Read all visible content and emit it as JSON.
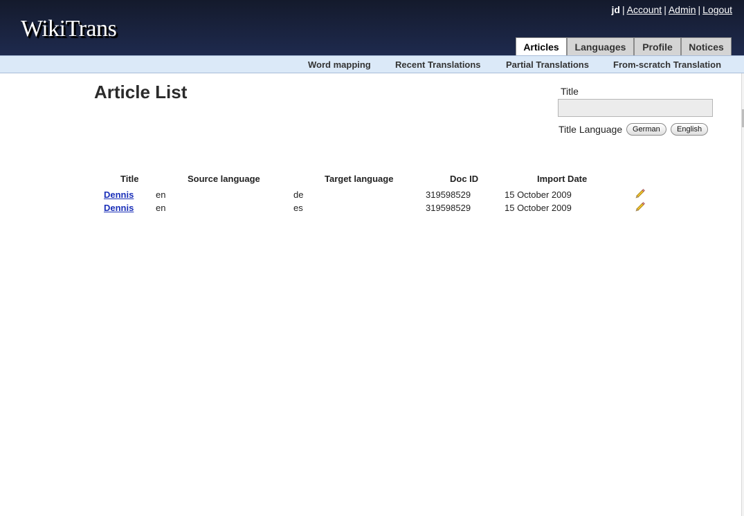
{
  "app": {
    "logo": "WikiTrans"
  },
  "userbar": {
    "username": "jd",
    "separator": "|",
    "links": [
      "Account",
      "Admin",
      "Logout"
    ]
  },
  "tabs": [
    {
      "label": "Articles",
      "active": true
    },
    {
      "label": "Languages",
      "active": false
    },
    {
      "label": "Profile",
      "active": false
    },
    {
      "label": "Notices",
      "active": false
    }
  ],
  "subnav": [
    "Word mapping",
    "Recent Translations",
    "Partial Translations",
    "From-scratch Translation"
  ],
  "page": {
    "title": "Article List"
  },
  "search": {
    "title_label": "Title",
    "title_value": "",
    "language_label": "Title Language",
    "languages": [
      "German",
      "English"
    ]
  },
  "table": {
    "headers": [
      "Title",
      "Source language",
      "Target language",
      "Doc ID",
      "Import Date"
    ],
    "rows": [
      {
        "title": "Dennis",
        "source": "en",
        "target": "de",
        "doc_id": "319598529",
        "date": "15 October 2009",
        "action_icon": "pencil-icon"
      },
      {
        "title": "Dennis",
        "source": "en",
        "target": "es",
        "doc_id": "319598529",
        "date": "15 October 2009",
        "action_icon": "pencil-icon"
      }
    ]
  },
  "colors": {
    "header_bg": "#1a2444",
    "subnav_bg": "#dbe9f8",
    "link": "#1a2fb8",
    "tab_inactive": "#d4d4d4"
  }
}
